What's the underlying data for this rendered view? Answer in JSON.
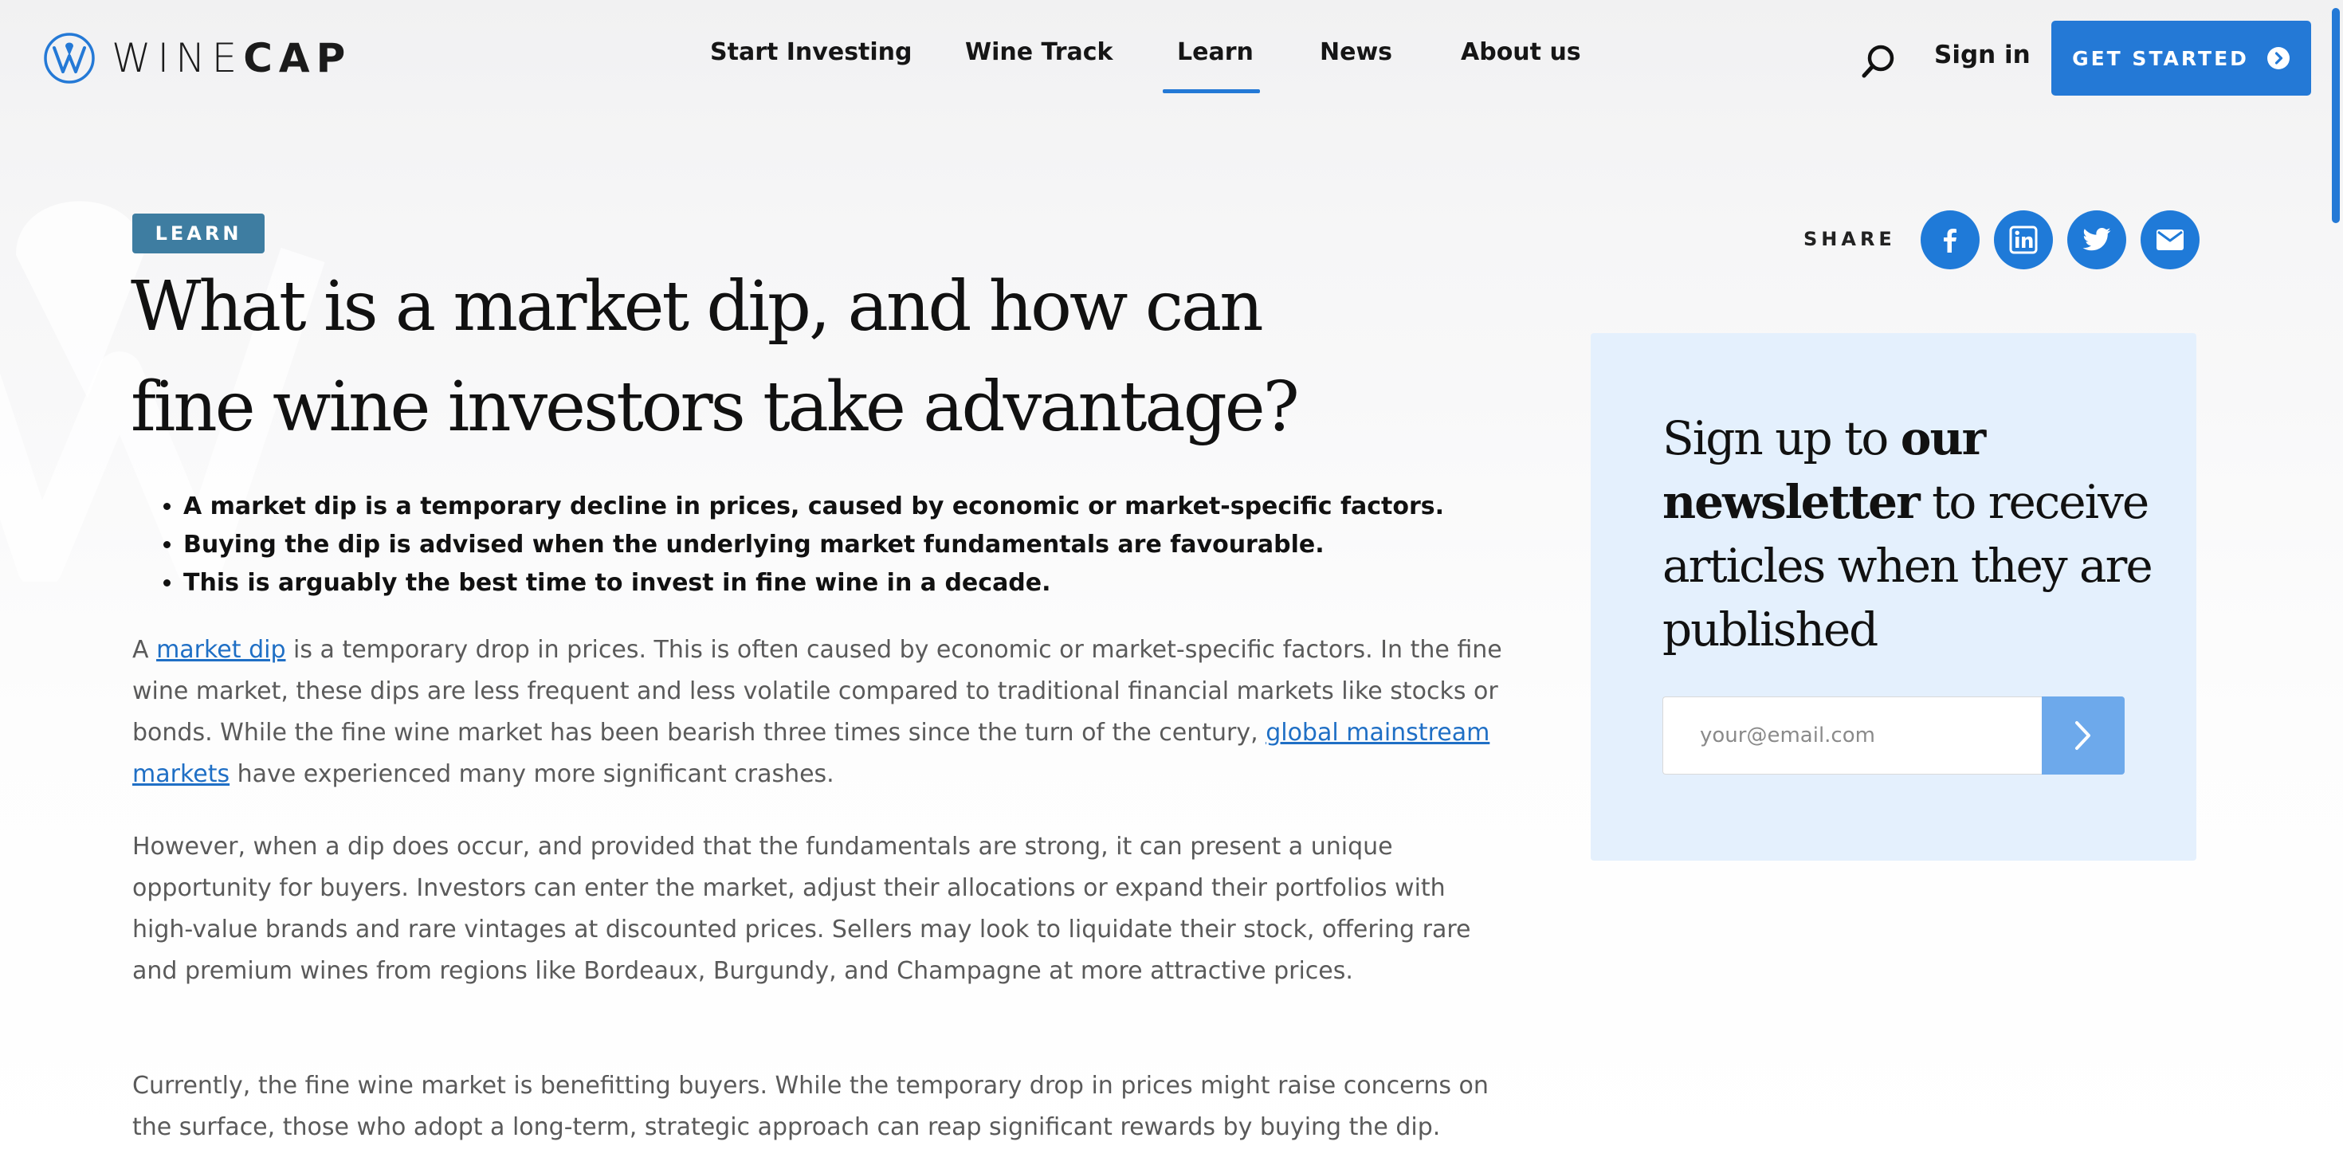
{
  "brand": {
    "name_light": "WINE",
    "name_bold": "CAP",
    "accent_color": "#2479d6"
  },
  "nav": {
    "items": [
      {
        "label": "Start Investing"
      },
      {
        "label": "Wine Track"
      },
      {
        "label": "Learn",
        "active": true
      },
      {
        "label": "News"
      },
      {
        "label": "About us"
      }
    ],
    "search_icon": "search-icon",
    "signin_label": "Sign in",
    "cta_label": "GET STARTED",
    "cta_icon": "chevron-right-circle-icon"
  },
  "article": {
    "category": "LEARN",
    "title": "What is a market dip, and how can fine wine investors take advantage?",
    "summary": [
      "A market dip is a temporary decline in prices, caused by economic or market-specific factors.",
      "Buying the dip is advised when the underlying market fundamentals are favourable.",
      "This is arguably the best time to invest in fine wine in a decade."
    ],
    "p1": {
      "prefix": "A ",
      "link1": "market dip",
      "middle": " is a temporary drop in prices. This is often caused by economic or market-specific factors. In the fine wine market, these dips are less frequent and less volatile compared to traditional financial markets like stocks or bonds. While the fine wine market has been bearish three times since the turn of the century, ",
      "link2": "global mainstream markets",
      "suffix": " have experienced many more significant crashes."
    },
    "p2": "However, when a dip does occur, and provided that the fundamentals are strong, it can present a unique opportunity for buyers. Investors can enter the market, adjust their allocations or expand their portfolios with high-value brands and rare vintages at discounted prices. Sellers may look to liquidate their stock, offering rare and premium wines from regions like Bordeaux, Burgundy, and Champagne at more attractive prices.",
    "p3": "Currently, the fine wine market is benefitting buyers. While the temporary drop in prices might raise concerns on the surface, those who adopt a long-term, strategic approach can reap significant rewards by buying the dip."
  },
  "share": {
    "label": "SHARE",
    "buttons": [
      "facebook-icon",
      "linkedin-icon",
      "twitter-icon",
      "email-icon"
    ],
    "button_color": "#1f7ad8"
  },
  "newsletter": {
    "heading_part1": "Sign up to ",
    "heading_bold": "our newsletter",
    "heading_part2": " to receive articles when they are published",
    "email_placeholder": "your@email.com",
    "email_value": "",
    "submit_icon": "chevron-right-icon",
    "background_color": "#e4f0fd",
    "submit_color": "#6da9eb"
  }
}
